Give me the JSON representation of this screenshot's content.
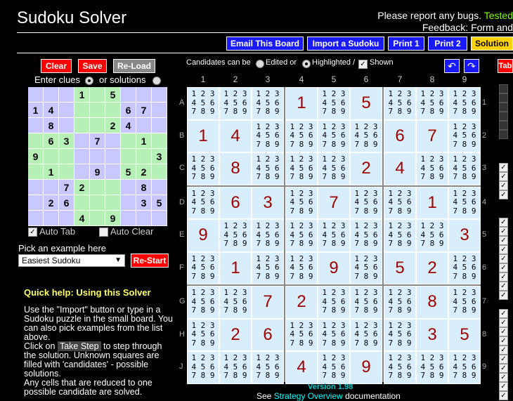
{
  "title": "Sudoku Solver",
  "header": {
    "bug_text": "Please report any bugs. ",
    "bug_text_green": "Tested",
    "feedback": "Feedback: Form and"
  },
  "toolbar": {
    "email": "Email This Board",
    "import": "Import a Sudoku",
    "print1": "Print 1",
    "print2": "Print 2",
    "solution": "Solution",
    "tab": "Tab"
  },
  "left": {
    "clear": "Clear",
    "save": "Save",
    "reload": "Re-Load",
    "enter_clues": "Enter clues",
    "or_solutions": "or solutions",
    "auto_tab": "Auto Tab",
    "auto_clear": "Auto Clear",
    "pick_example": "Pick an example here",
    "example_selected": "Easiest Sudoku",
    "restart": "Re-Start"
  },
  "candidates_bar": {
    "label": "Candidates can be",
    "edited": "Edited or",
    "highlighted": "Highlighted /",
    "shown": "Shown"
  },
  "help": {
    "title": "Quick help: Using this Solver",
    "p1": "Use the \"Import\" button or type in a Sudoku puzzle in the small board. You can also pick examples from the list above.",
    "p2a": "Click on ",
    "take_step": "Take Step",
    "p2b": " to step through the solution. Unknown squares are filled with 'candidates' - possible solutions.",
    "p3": "Any cells that are reduced to one possible candidate are solved."
  },
  "footer": {
    "version": "Version 1.98",
    "see": "See ",
    "strategy": "Strategy Overview",
    "documentation": " documentation"
  },
  "col_headers": [
    "1",
    "2",
    "3",
    "4",
    "5",
    "6",
    "7",
    "8",
    "9"
  ],
  "row_headers": [
    "A",
    "B",
    "C",
    "D",
    "E",
    "F",
    "G",
    "H",
    "J"
  ],
  "grid": [
    [
      "",
      "",
      "",
      "1",
      "",
      "5",
      "",
      "",
      ""
    ],
    [
      "1",
      "4",
      "",
      "",
      "",
      "",
      "6",
      "7",
      ""
    ],
    [
      "",
      "8",
      "",
      "",
      "",
      "2",
      "4",
      "",
      ""
    ],
    [
      "",
      "6",
      "3",
      "",
      "7",
      "",
      "",
      "1",
      ""
    ],
    [
      "9",
      "",
      "",
      "",
      "",
      "",
      "",
      "",
      "3"
    ],
    [
      "",
      "1",
      "",
      "",
      "9",
      "",
      "5",
      "2",
      ""
    ],
    [
      "",
      "",
      "7",
      "2",
      "",
      "",
      "",
      "8",
      ""
    ],
    [
      "",
      "2",
      "6",
      "",
      "",
      "",
      "",
      "3",
      "5"
    ],
    [
      "",
      "",
      "",
      "4",
      "",
      "9",
      "",
      "",
      ""
    ]
  ],
  "candidate_text": "1 2 3\n4 5 6\n7 8 9",
  "colors": {
    "accent_blue": "#1a1aff",
    "red": "#ff0000",
    "solution": "#ffd200",
    "digit": "#a00000"
  }
}
